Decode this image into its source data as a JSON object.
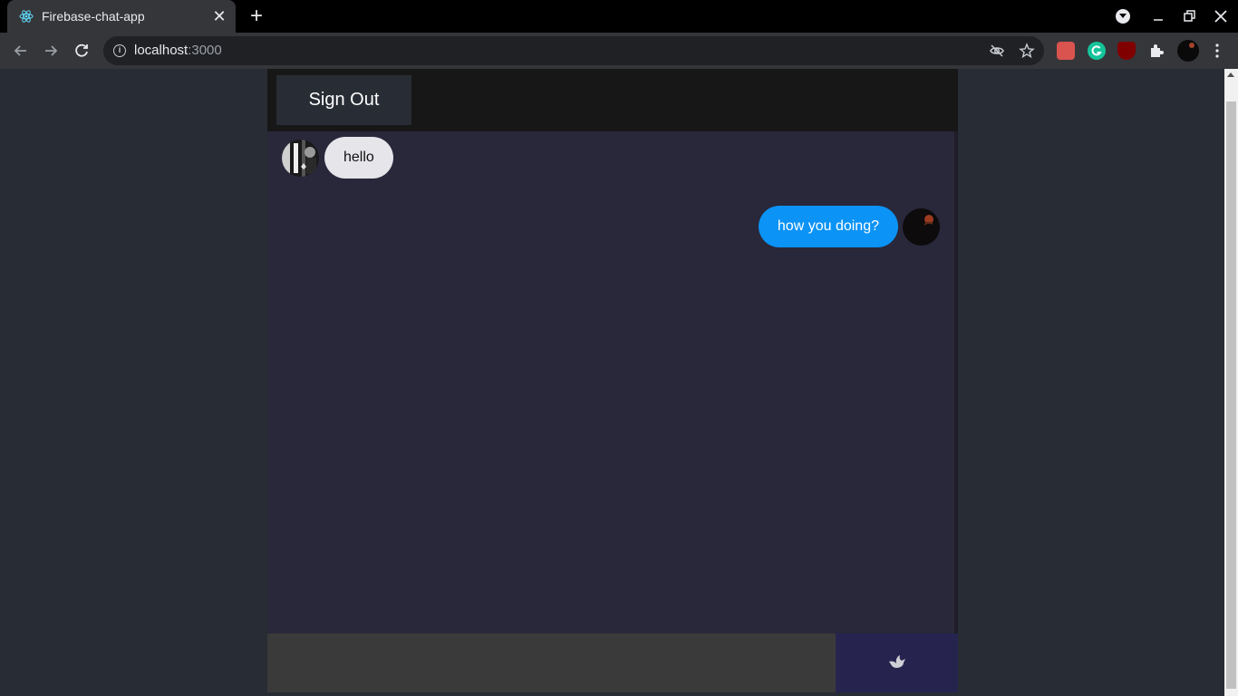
{
  "browser": {
    "tab_title": "Firebase-chat-app",
    "tab_close": "✕",
    "new_tab": "+",
    "url_host": "localhost",
    "url_port": ":3000"
  },
  "app": {
    "signout_label": "Sign Out",
    "messages": [
      {
        "type": "received",
        "text": "hello"
      },
      {
        "type": "sent",
        "text": "how you doing?"
      }
    ],
    "send_icon": "dove-icon"
  },
  "colors": {
    "received_bubble": "#e5e5ea",
    "sent_bubble": "#0b93f6",
    "chat_bg": "#29273a",
    "header_bg": "#181717",
    "send_bg": "#26244f"
  }
}
